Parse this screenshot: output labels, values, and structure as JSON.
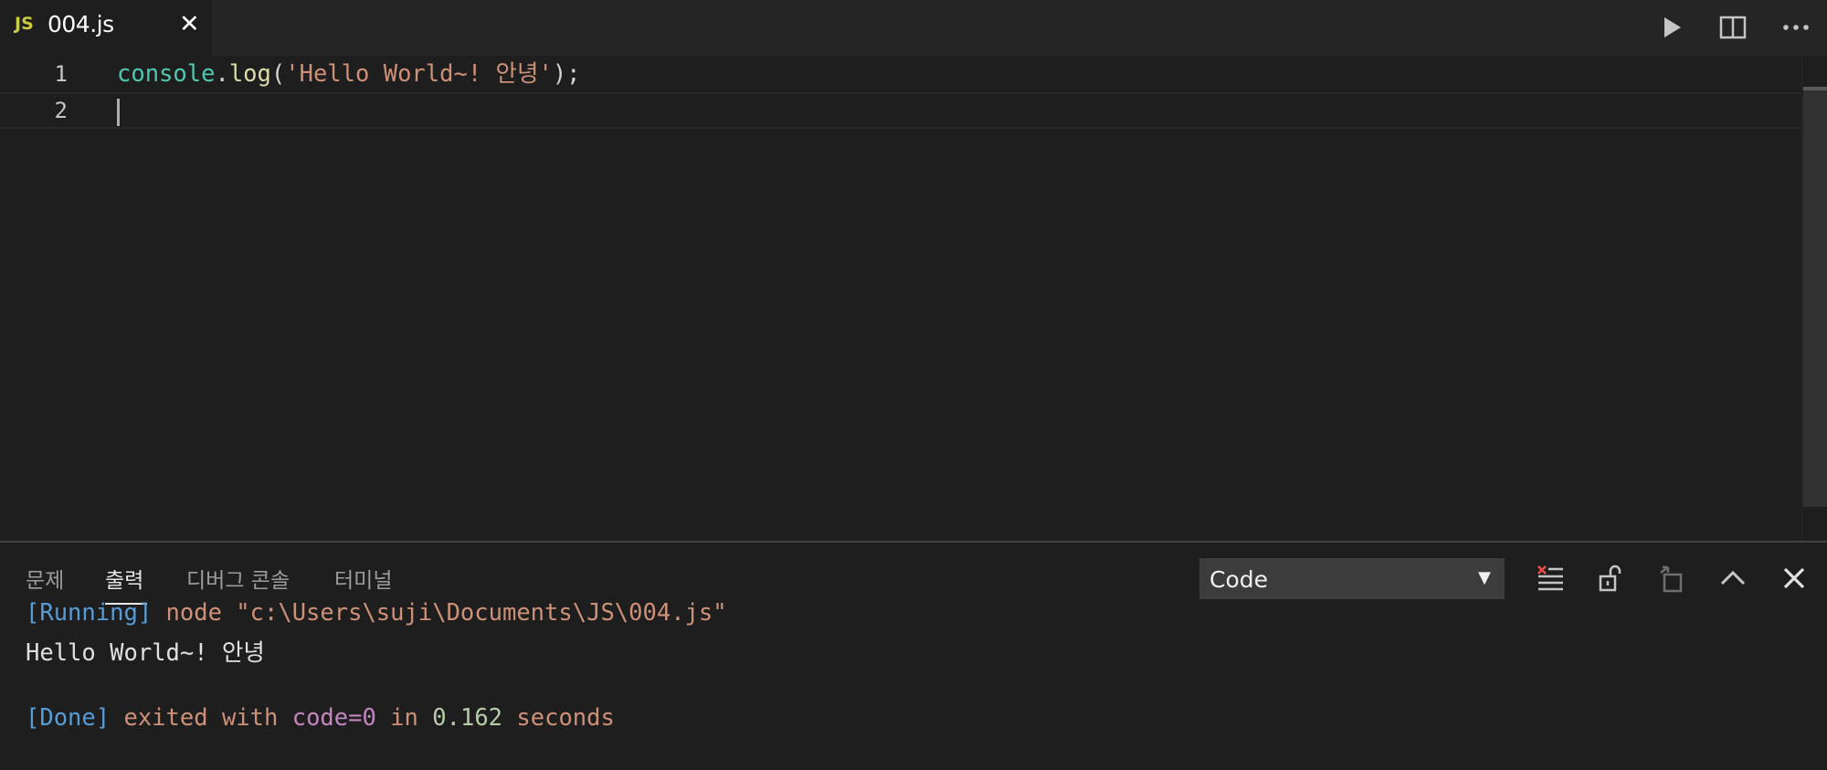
{
  "tab": {
    "icon_text": "JS",
    "filename": "004.js",
    "close_glyph": "✕"
  },
  "toolbar": {
    "run_icon": "play-icon",
    "split_icon": "split-editor-icon",
    "more_icon": "more-actions-icon"
  },
  "editor": {
    "lines": [
      {
        "number": "1",
        "tokens": {
          "obj": "console",
          "dot": ".",
          "fn": "log",
          "open": "(",
          "str": "'Hello World~! 안녕'",
          "close": ");"
        }
      },
      {
        "number": "2"
      }
    ]
  },
  "panel": {
    "tabs": [
      "문제",
      "출력",
      "디버그 콘솔",
      "터미널"
    ],
    "active_tab": "출력",
    "channel_select": {
      "value": "Code",
      "arrow": "▼"
    },
    "output": {
      "line1": {
        "tag": "[Running]",
        "text": " node \"c:\\Users\\suji\\Documents\\JS\\004.js\""
      },
      "line2": "Hello World~! 안녕",
      "line4": {
        "tag": "[Done]",
        "exited": " exited with ",
        "code": "code=0",
        "in": " in ",
        "time": "0.162",
        "seconds": " seconds"
      }
    }
  },
  "colors": {
    "editor_bg": "#1e1e1e",
    "tabbar_bg": "#252526",
    "js_icon": "#cbcb41",
    "string": "#ce9178",
    "identifier": "#4ec9b0",
    "function": "#dcdcaa",
    "keyword_blue": "#569cd6",
    "purple": "#c586c0",
    "number_green": "#b5cea8"
  }
}
